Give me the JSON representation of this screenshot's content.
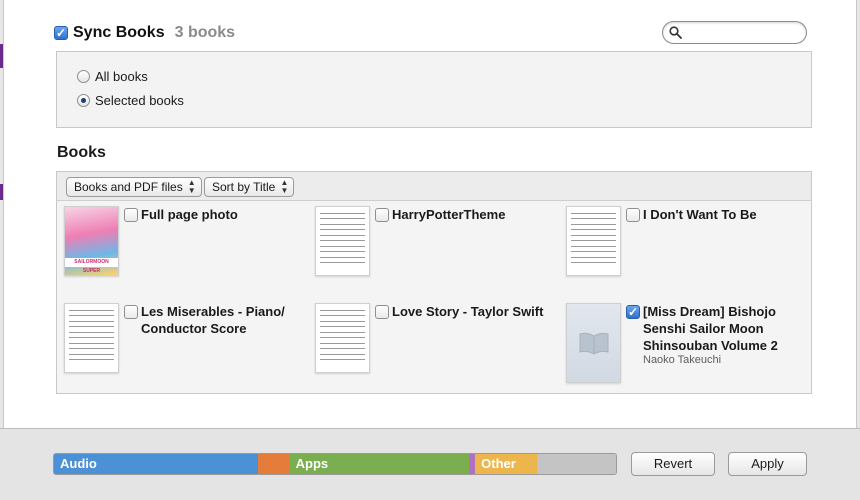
{
  "sync": {
    "title": "Sync Books",
    "count": "3 books",
    "checked": true
  },
  "search": {
    "placeholder": "",
    "icon": "search-icon"
  },
  "options": {
    "all_label": "All books",
    "selected_label": "Selected books",
    "selected": "Selected books"
  },
  "books_section": {
    "heading": "Books",
    "filter_popup": "Books and PDF files",
    "sort_popup": "Sort by Title",
    "items": [
      {
        "title": "Full page photo",
        "checked": false,
        "cover": "manga-cover",
        "cover_text": "SAILORMOON SUPER"
      },
      {
        "title": "HarryPotterTheme",
        "checked": false,
        "cover": "sheet-music"
      },
      {
        "title": "I Don't Want To Be",
        "checked": false,
        "cover": "sheet-music"
      },
      {
        "title": "Les Miserables - Piano/ Conductor Score",
        "checked": false,
        "cover": "sheet-music"
      },
      {
        "title": "Love Story - Taylor Swift",
        "checked": false,
        "cover": "sheet-music"
      },
      {
        "title": "[Miss Dream] Bishojo Senshi Sailor Moon Shinsouban Volume 2",
        "author": "Naoko Takeuchi",
        "checked": true,
        "cover": "book-placeholder-icon"
      }
    ]
  },
  "footer": {
    "capacity": [
      {
        "label": "Audio",
        "color": "#4c90d6",
        "fraction": 0.363
      },
      {
        "label": "",
        "color": "#e47c3a",
        "fraction": 0.057
      },
      {
        "label": "Apps",
        "color": "#7aae4f",
        "fraction": 0.32
      },
      {
        "label": "",
        "color": "#b06fc0",
        "fraction": 0.009
      },
      {
        "label": "Other",
        "color": "#edb64c",
        "fraction": 0.11
      },
      {
        "label": "",
        "color": "#c4c4c4",
        "fraction": 0.141
      }
    ],
    "revert_label": "Revert",
    "apply_label": "Apply"
  }
}
